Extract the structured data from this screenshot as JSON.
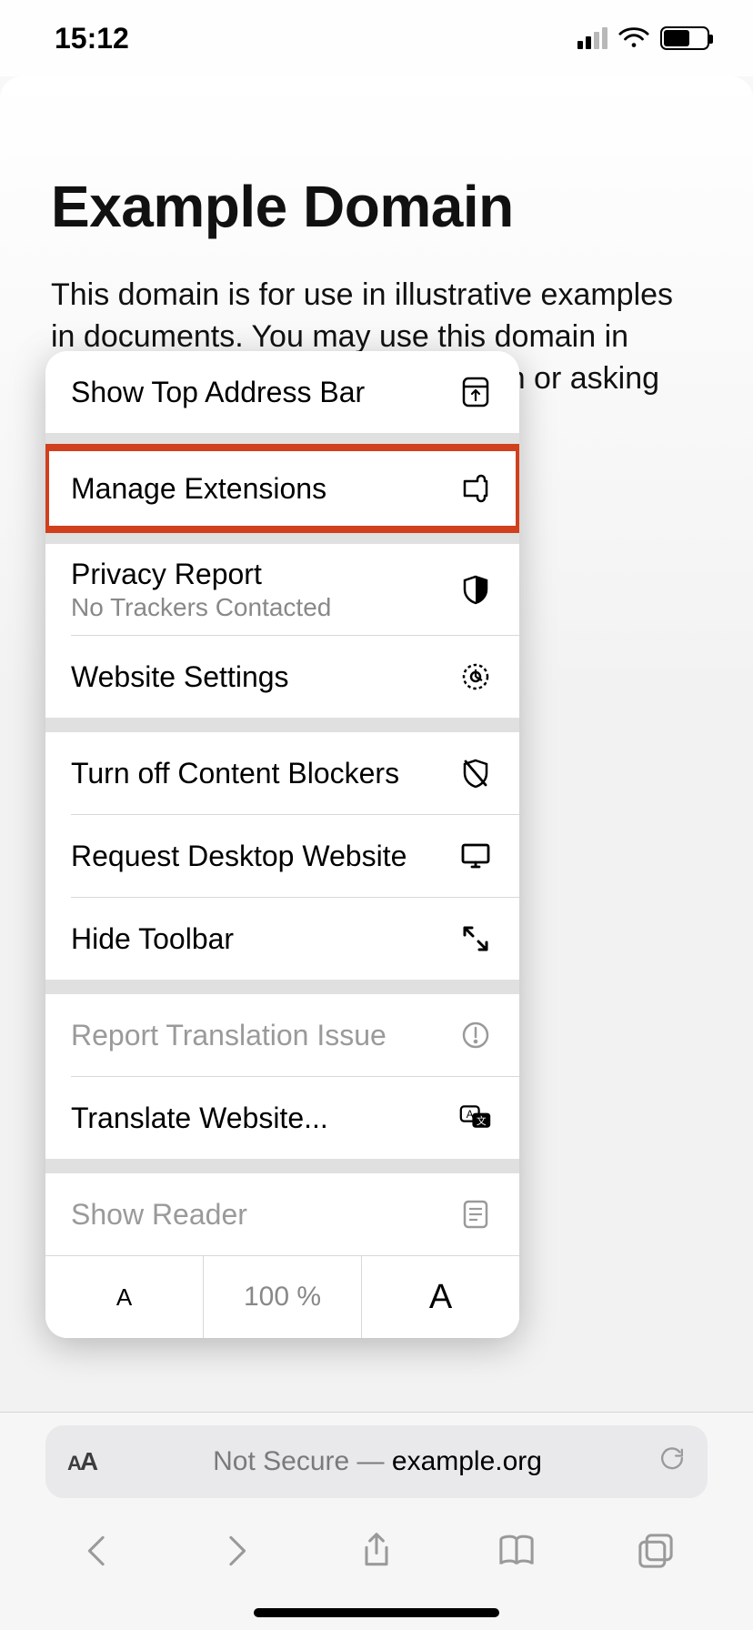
{
  "status": {
    "time": "15:12"
  },
  "page": {
    "title": "Example Domain",
    "paragraph": "This domain is for use in illustrative examples in documents. You may use this domain in literature without prior coordination or asking"
  },
  "menu": {
    "show_top_address_bar": "Show Top Address Bar",
    "manage_extensions": "Manage Extensions",
    "privacy_report": "Privacy Report",
    "privacy_report_sub": "No Trackers Contacted",
    "website_settings": "Website Settings",
    "turn_off_content_blockers": "Turn off Content Blockers",
    "request_desktop_website": "Request Desktop Website",
    "hide_toolbar": "Hide Toolbar",
    "report_translation_issue": "Report Translation Issue",
    "translate_website": "Translate Website...",
    "show_reader": "Show Reader",
    "zoom_percent": "100 %",
    "zoom_small": "A",
    "zoom_big": "A"
  },
  "urlbar": {
    "aa_small": "A",
    "aa_big": "A",
    "not_secure": "Not Secure — ",
    "domain": "example.org"
  }
}
